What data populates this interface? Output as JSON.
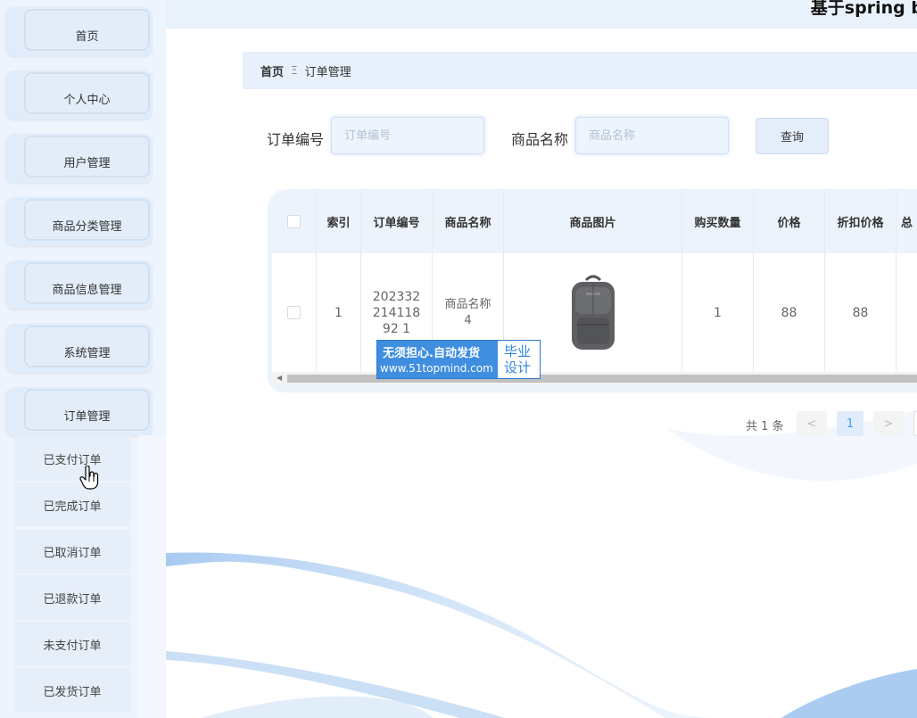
{
  "header": {
    "title": "基于spring bo"
  },
  "sidebar": {
    "items": [
      {
        "label": "首页"
      },
      {
        "label": "个人中心"
      },
      {
        "label": "用户管理"
      },
      {
        "label": "商品分类管理"
      },
      {
        "label": "商品信息管理"
      },
      {
        "label": "系统管理"
      },
      {
        "label": "订单管理"
      }
    ],
    "subitems": [
      {
        "label": "已支付订单"
      },
      {
        "label": "已完成订单"
      },
      {
        "label": "已取消订单"
      },
      {
        "label": "已退款订单"
      },
      {
        "label": "未支付订单"
      },
      {
        "label": "已发货订单"
      }
    ]
  },
  "breadcrumb": {
    "home": "首页",
    "separator": "Ξ",
    "current": "订单管理"
  },
  "search": {
    "order_no_label": "订单编号",
    "order_no_placeholder": "订单编号",
    "product_name_label": "商品名称",
    "product_name_placeholder": "商品名称",
    "query_button": "查询"
  },
  "table": {
    "headers": [
      "索引",
      "订单编号",
      "商品名称",
      "商品图片",
      "购买数量",
      "价格",
      "折扣价格",
      "总"
    ],
    "rows": [
      {
        "index": "1",
        "order_no": "20233221411892 1",
        "product_name": "商品名称4",
        "image": "backpack-image",
        "quantity": "1",
        "price": "88",
        "discount_price": "88"
      }
    ]
  },
  "watermark": {
    "line1": "无须担心.自动发货",
    "line2": "www.51topmind.com",
    "right": "毕业设计"
  },
  "pagination": {
    "total": "共 1 条",
    "prev": "<",
    "current": "1",
    "next": ">"
  },
  "colors": {
    "sidebar_bg": "#eef4fd",
    "menu_bg": "#e1ecfa",
    "accent": "#409eff",
    "watermark_blue": "#3f8ee0"
  }
}
